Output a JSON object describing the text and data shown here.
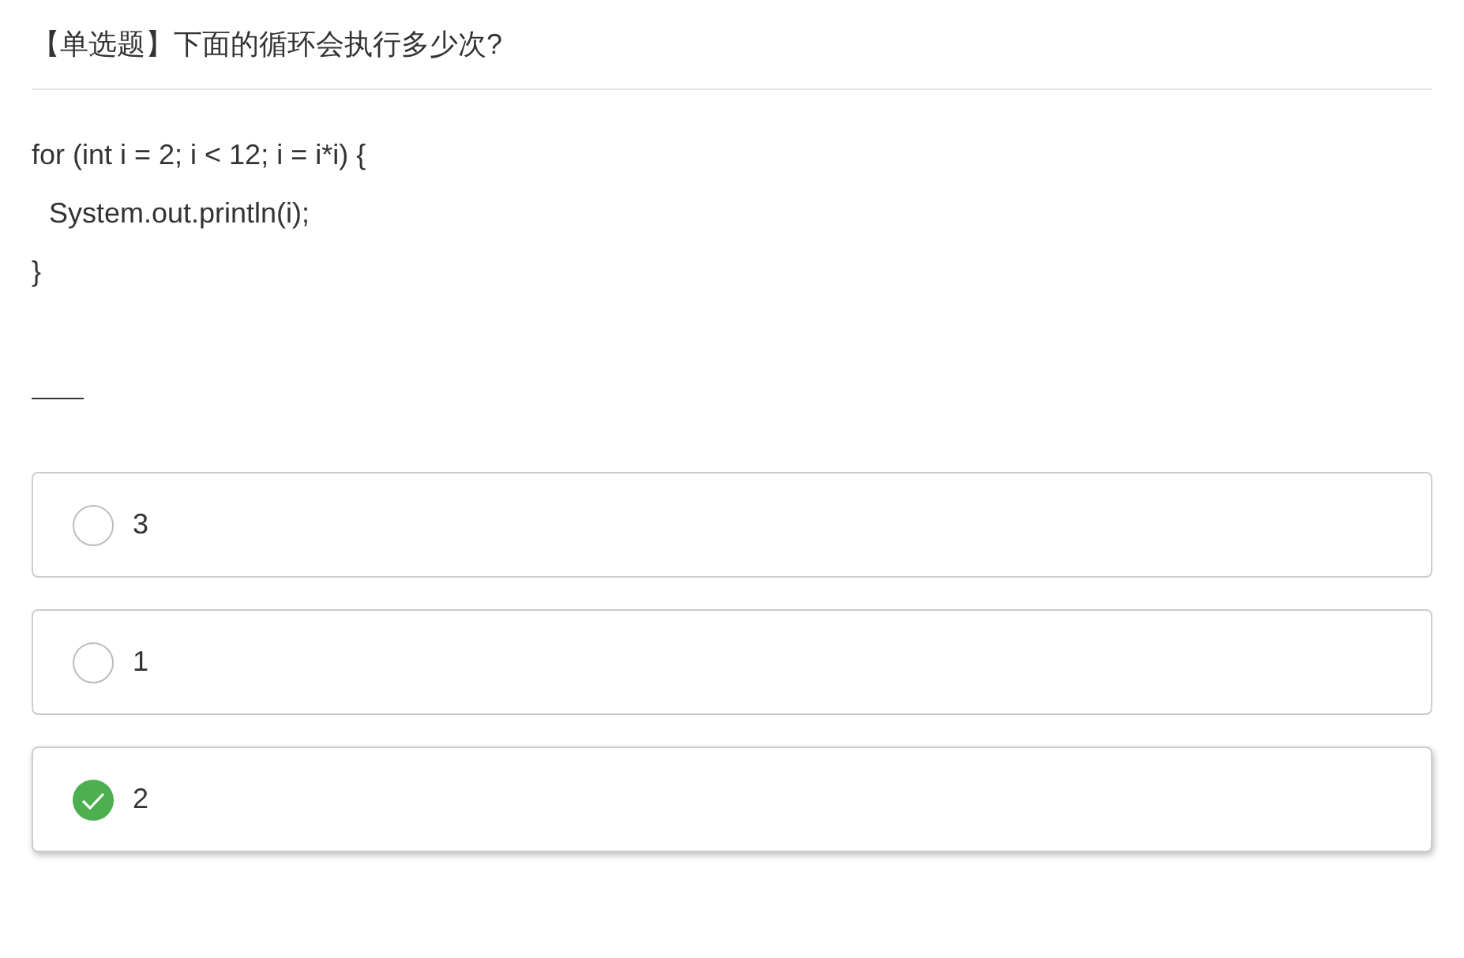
{
  "question": {
    "title": "【单选题】下面的循环会执行多少次?",
    "code_lines": [
      {
        "text": "for (int i = 2; i < 12; i = i*i) {",
        "children": [
          {
            "text": "System.out.println(i);"
          }
        ]
      },
      {
        "text": "}"
      }
    ]
  },
  "options": [
    {
      "label": "3",
      "selected": false
    },
    {
      "label": "1",
      "selected": false
    },
    {
      "label": "2",
      "selected": true
    }
  ]
}
